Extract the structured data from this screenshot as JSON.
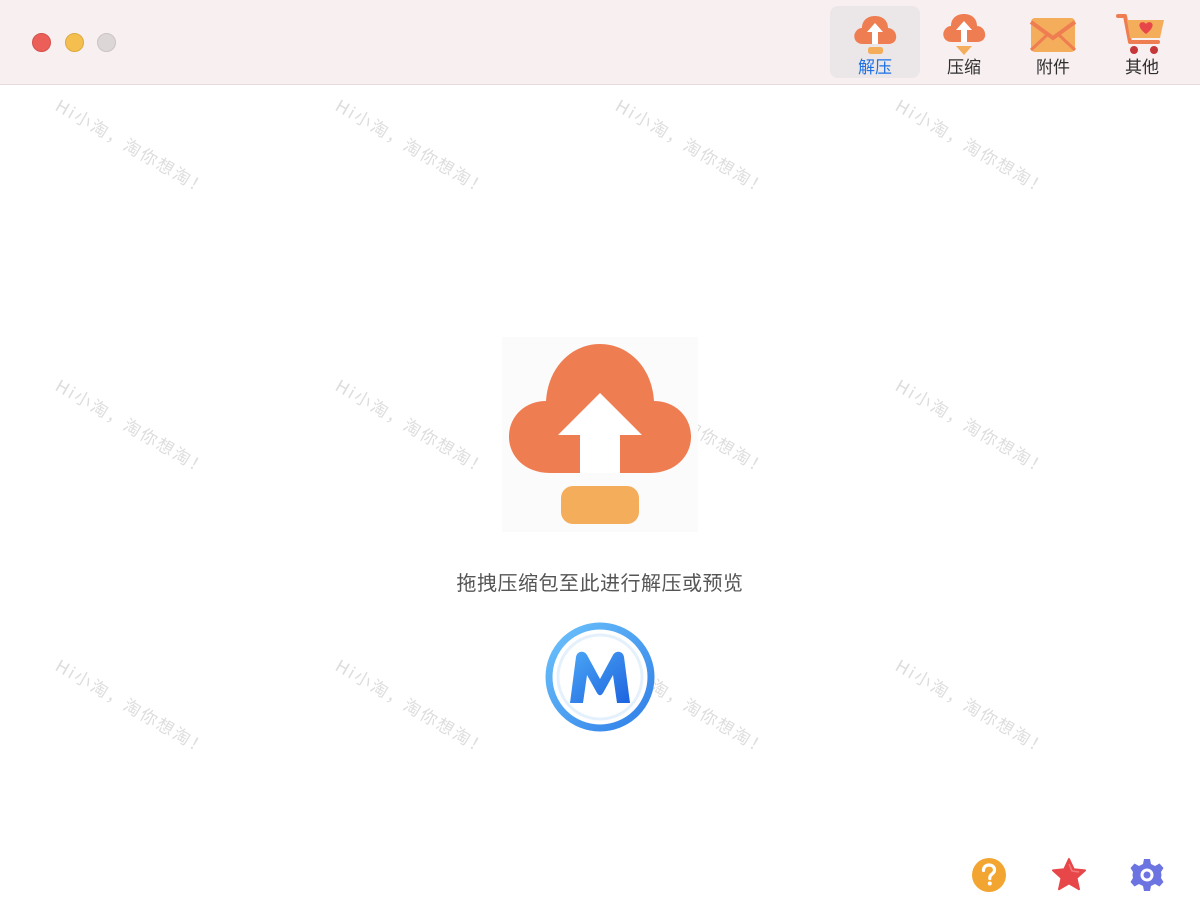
{
  "window": {
    "controls": [
      "close",
      "minimize",
      "zoom"
    ]
  },
  "toolbar": {
    "tabs": [
      {
        "label": "解压",
        "icon": "cloud-upload-icon",
        "active": true
      },
      {
        "label": "压缩",
        "icon": "cloud-download-icon",
        "active": false
      },
      {
        "label": "附件",
        "icon": "envelope-icon",
        "active": false
      },
      {
        "label": "其他",
        "icon": "shopping-cart-icon",
        "active": false
      }
    ]
  },
  "main": {
    "drop_icon": "cloud-upload-icon",
    "drop_hint": "拖拽压缩包至此进行解压或预览",
    "logo": "m-logo-icon"
  },
  "watermark": {
    "text": "Hi小淘，淘你想淘！"
  },
  "footer": {
    "buttons": [
      {
        "icon": "help-icon"
      },
      {
        "icon": "star-icon"
      },
      {
        "icon": "gear-icon"
      }
    ]
  },
  "colors": {
    "accent_blue": "#1e72e6",
    "cloud_orange": "#ef7d52",
    "tray_orange": "#f4ad5b",
    "titlebar_bg": "#f8eff0",
    "star_red": "#e8474a",
    "gear_purple": "#6b74e0",
    "help_orange": "#f2a531"
  }
}
